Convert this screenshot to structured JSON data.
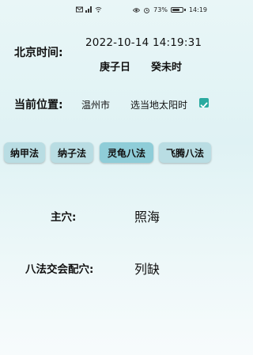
{
  "status_bar": {
    "battery_percent": "73%",
    "battery_level": 0.73,
    "time": "14:19",
    "icons": [
      "mail-icon",
      "signal-icon",
      "wifi-icon",
      "eye-icon",
      "alarm-icon",
      "battery-icon"
    ]
  },
  "beijing_time": {
    "label": "北京时间:",
    "datetime": "2022-10-14 14:19:31",
    "ganzhi_day": "庚子日",
    "ganzhi_hour": "癸未时"
  },
  "location": {
    "label": "当前位置:",
    "city": "温州市",
    "solar_time_label": "选当地太阳时",
    "solar_time_checked": true
  },
  "methods": {
    "active": "灵龟八法",
    "buttons": [
      "纳甲法",
      "纳子法",
      "灵龟八法",
      "飞腾八法"
    ]
  },
  "result": {
    "main_point_label": "主穴:",
    "main_point_value": "照海",
    "paired_point_label": "八法交会配穴:",
    "paired_point_value": "列缺"
  },
  "colors": {
    "accent": "#2aaaa0",
    "button_bg": "#b9dde3"
  }
}
